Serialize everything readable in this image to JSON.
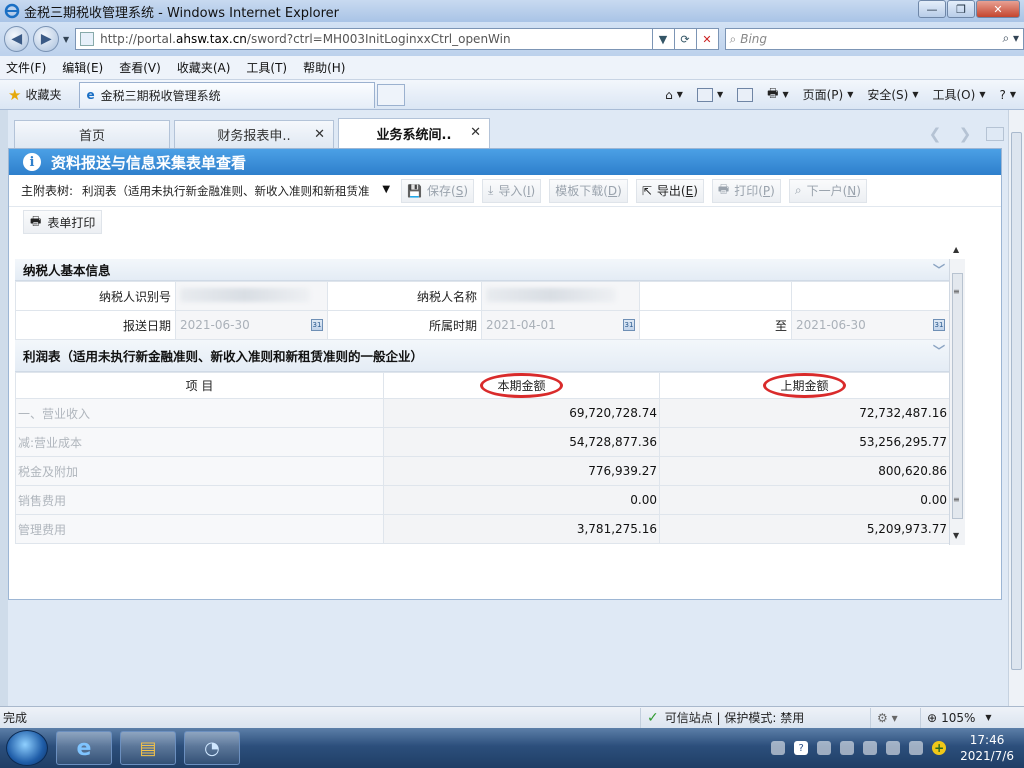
{
  "window": {
    "title": "金税三期税收管理系统 - Windows Internet Explorer",
    "url_prefix": "http://portal.",
    "url_domain": "ahsw.tax.cn",
    "url_suffix": "/sword?ctrl=MH003InitLoginxxCtrl_openWin",
    "search_placeholder": "Bing"
  },
  "menu": [
    "文件(F)",
    "编辑(E)",
    "查看(V)",
    "收藏夹(A)",
    "工具(T)",
    "帮助(H)"
  ],
  "favorites": {
    "label": "收藏夹",
    "tab_title": "金税三期税收管理系统"
  },
  "commands": {
    "page": "页面(P)",
    "safety": "安全(S)",
    "tools": "工具(O)"
  },
  "app_tabs": [
    {
      "label": "首页",
      "closable": false,
      "active": false
    },
    {
      "label": "财务报表申..",
      "closable": true,
      "active": false
    },
    {
      "label": "业务系统间..",
      "closable": true,
      "active": true
    }
  ],
  "panel": {
    "title": "资料报送与信息采集表单查看"
  },
  "toolbar": {
    "label": "主附表树:",
    "selected": "利润表（适用未执行新金融准则、新收入准则和新租赁准",
    "save_text": "保存(",
    "save_key": "S",
    "import_text": "导入(",
    "import_key": "I",
    "template_text": "模板下载(",
    "template_key": "D",
    "export_text": "导出(",
    "export_key": "E",
    "print_text": "打印(",
    "print_key": "P",
    "next_text": "下一户(",
    "next_key": "N",
    "close_paren": ")",
    "form_print": "表单打印"
  },
  "basic_info": {
    "heading": "纳税人基本信息",
    "taxpayer_id_label": "纳税人识别号",
    "taxpayer_name_label": "纳税人名称",
    "report_date_label": "报送日期",
    "report_date": "2021-06-30",
    "period_label": "所属时期",
    "period_start": "2021-04-01",
    "to_label": "至",
    "period_end": "2021-06-30"
  },
  "income": {
    "heading": "利润表（适用未执行新金融准则、新收入准则和新租赁准则的一般企业）",
    "col_item": "项 目",
    "col_current": "本期金额",
    "col_prior": "上期金额",
    "rows": [
      {
        "item": "一、营业收入",
        "current": "69,720,728.74",
        "prior": "72,732,487.16"
      },
      {
        "item": "减:营业成本",
        "current": "54,728,877.36",
        "prior": "53,256,295.77"
      },
      {
        "item": "税金及附加",
        "current": "776,939.27",
        "prior": "800,620.86"
      },
      {
        "item": "销售费用",
        "current": "0.00",
        "prior": "0.00"
      },
      {
        "item": "管理费用",
        "current": "3,781,275.16",
        "prior": "5,209,973.77"
      }
    ]
  },
  "status": {
    "left": "完成",
    "zone": "可信站点 | 保护模式: 禁用",
    "zoom": "105%"
  },
  "taskbar": {
    "time": "17:46",
    "date": "2021/7/6"
  }
}
